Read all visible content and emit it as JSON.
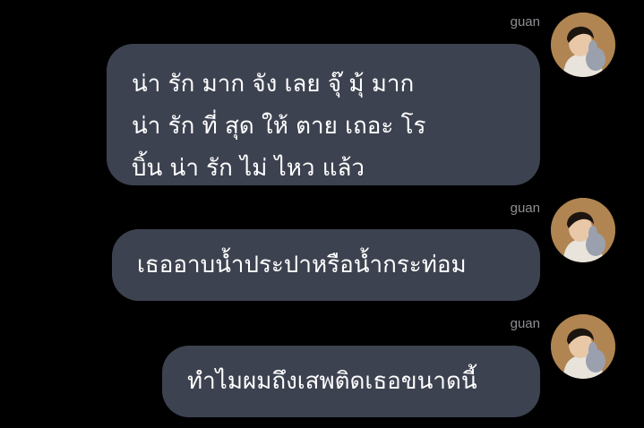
{
  "chat": {
    "messages": [
      {
        "sender": "guan",
        "lines": [
          "น่า รัก มาก จัง เลย จุ๊ มุ้ มาก",
          "น่า รัก ที่ สุด ให้ ตาย เถอะ โร",
          "บิ้น น่า รัก ไม่ ไหว แล้ว"
        ]
      },
      {
        "sender": "guan",
        "lines": [
          "เธออาบน้ำประปาหรือน้ำกระท่อม"
        ]
      },
      {
        "sender": "guan",
        "lines": [
          "ทำไมผมถึงเสพติดเธอขนาดนี้"
        ]
      }
    ]
  },
  "colors": {
    "background": "#000000",
    "bubble": "#3d4250",
    "bubble_text": "#ffffff",
    "sender_name": "#8e8e93"
  },
  "icons": {
    "avatar": "user-avatar-photo"
  }
}
